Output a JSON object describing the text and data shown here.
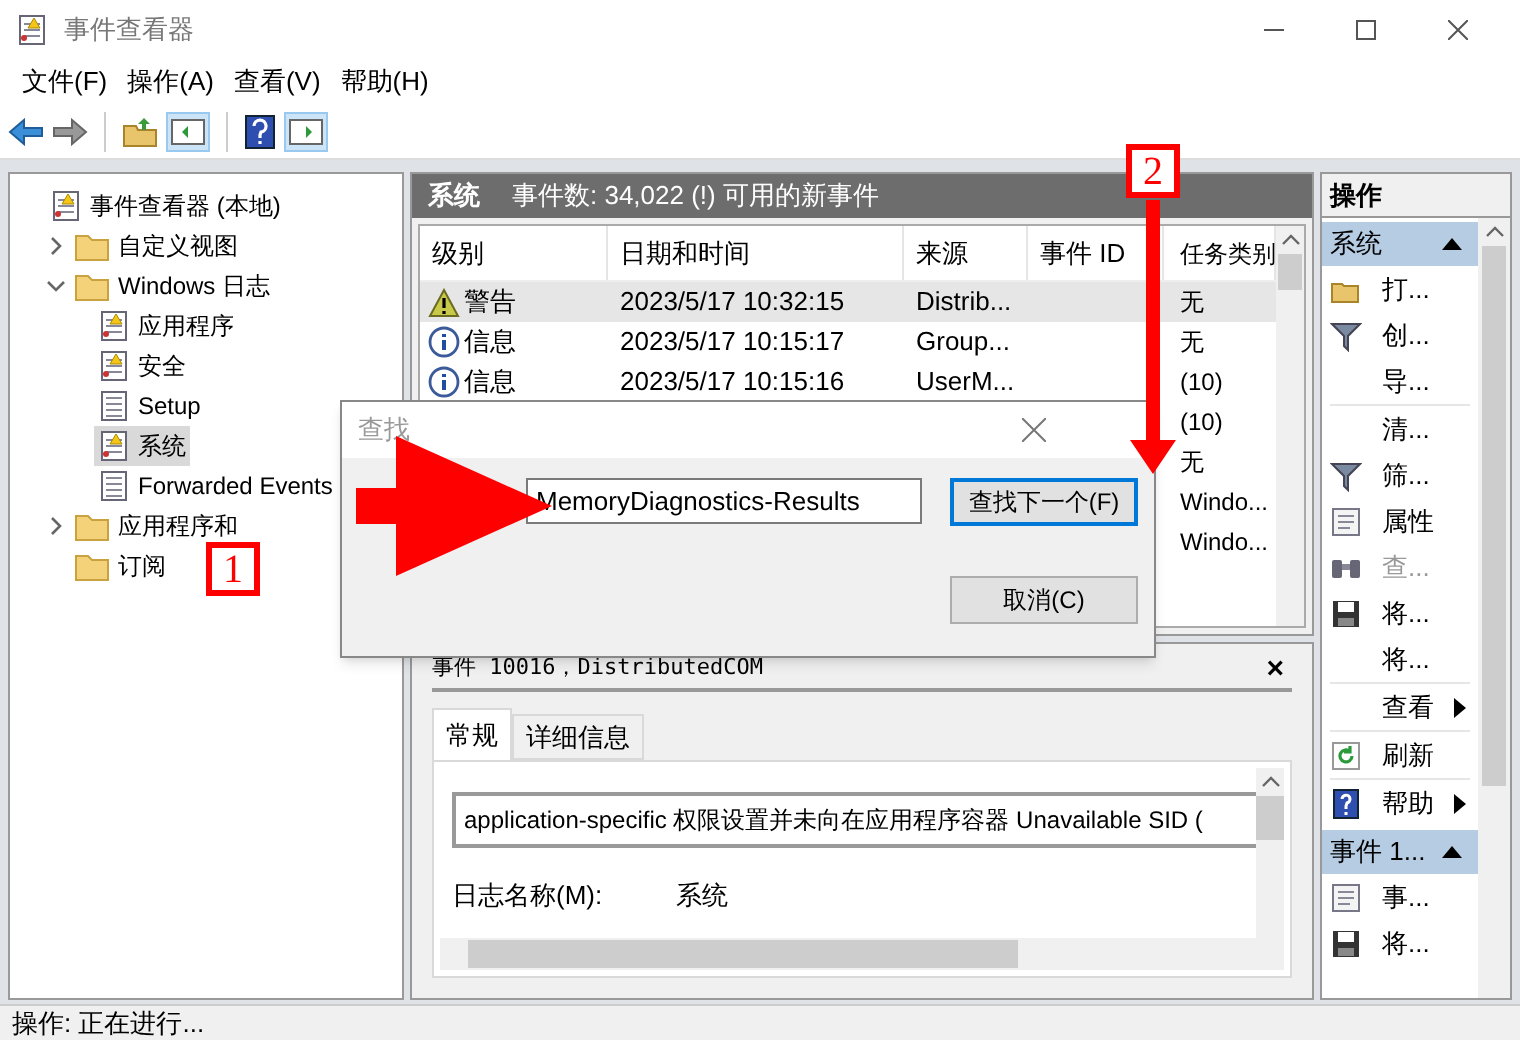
{
  "window": {
    "title": "事件查看器"
  },
  "menu": [
    "文件(F)",
    "操作(A)",
    "查看(V)",
    "帮助(H)"
  ],
  "tree": [
    {
      "label": "事件查看器 (本地)",
      "kind": "log",
      "selected": false,
      "children": [
        {
          "label": "自定义视图",
          "kind": "folder",
          "selected": false,
          "expanded": false
        },
        {
          "label": "Windows 日志",
          "kind": "folder",
          "selected": false,
          "expanded": true,
          "children": [
            {
              "label": "应用程序",
              "kind": "log",
              "selected": false
            },
            {
              "label": "安全",
              "kind": "log",
              "selected": false
            },
            {
              "label": "Setup",
              "kind": "page",
              "selected": false
            },
            {
              "label": "系统",
              "kind": "log",
              "selected": true
            },
            {
              "label": "Forwarded Events",
              "kind": "page",
              "selected": false
            }
          ]
        },
        {
          "label": "应用程序和",
          "kind": "folder",
          "selected": false,
          "expanded": false
        },
        {
          "label": "订阅",
          "kind": "folder",
          "selected": false
        }
      ]
    }
  ],
  "events_header": {
    "title": "系统",
    "summary": "事件数: 34,022 (!) 可用的新事件"
  },
  "table": {
    "columns": [
      "级别",
      "日期和时间",
      "来源",
      "事件 ID",
      "任务类别"
    ],
    "rows": [
      {
        "kind": "warning",
        "level": "警告",
        "date": "2023/5/17 10:32:15",
        "source": "Distrib...",
        "task": "无",
        "selected": true
      },
      {
        "kind": "info",
        "level": "信息",
        "date": "2023/5/17 10:15:17",
        "source": "Group...",
        "task": "无",
        "selected": false
      },
      {
        "kind": "info",
        "level": "信息",
        "date": "2023/5/17 10:15:16",
        "source": "UserM...",
        "task": "(10)",
        "selected": false
      },
      {
        "task": "(10)",
        "selected": false
      },
      {
        "task": "无",
        "selected": false
      },
      {
        "task": "Windo...",
        "selected": false
      },
      {
        "task": "Windo...",
        "selected": false
      }
    ]
  },
  "detail": {
    "title": "事件 10016，DistributedCOM",
    "close": "×",
    "tabs": [
      {
        "label": "常规",
        "selected": true
      },
      {
        "label": "详细信息",
        "selected": false
      }
    ],
    "description": "application-specific 权限设置并未向在应用程序容器 Unavailable SID (",
    "fields": [
      {
        "label": "日志名称(M):",
        "value": "系统"
      }
    ]
  },
  "actions": {
    "title": "操作",
    "sections": [
      {
        "title": "系统",
        "expanded": true,
        "groups": [
          [
            {
              "label": "打...",
              "kind": "open",
              "disabled": false,
              "submenu": false
            },
            {
              "label": "创...",
              "kind": "filter",
              "disabled": false,
              "submenu": false
            },
            {
              "label": "导...",
              "kind": "plain",
              "disabled": false,
              "submenu": false
            }
          ],
          [
            {
              "label": "清...",
              "kind": "plain",
              "disabled": false,
              "submenu": false
            },
            {
              "label": "筛...",
              "kind": "filter",
              "disabled": false,
              "submenu": false
            },
            {
              "label": "属性",
              "kind": "sheet",
              "disabled": false,
              "submenu": false
            },
            {
              "label": "查...",
              "kind": "binoculars",
              "disabled": true,
              "submenu": false
            },
            {
              "label": "将...",
              "kind": "save",
              "disabled": false,
              "submenu": false
            },
            {
              "label": "将...",
              "kind": "plain",
              "disabled": false,
              "submenu": false
            }
          ],
          [
            {
              "label": "查看",
              "kind": "plain",
              "disabled": false,
              "submenu": true
            }
          ],
          [
            {
              "label": "刷新",
              "kind": "refresh",
              "disabled": false,
              "submenu": false
            }
          ],
          [
            {
              "label": "帮助",
              "kind": "help",
              "disabled": false,
              "submenu": true
            }
          ]
        ]
      },
      {
        "title": "事件 1...",
        "expanded": true,
        "groups": [
          [
            {
              "label": "事...",
              "kind": "sheet",
              "disabled": false,
              "submenu": false
            },
            {
              "label": "将...",
              "kind": "save",
              "disabled": false,
              "submenu": false
            }
          ]
        ]
      }
    ]
  },
  "find_dialog": {
    "title": "查找",
    "value": "MemoryDiagnostics-Results",
    "buttons": [
      {
        "label": "查找下一个(F)",
        "default": true
      },
      {
        "label": "取消(C)",
        "default": false
      }
    ]
  },
  "annotations": [
    {
      "label": "1"
    },
    {
      "label": "2"
    }
  ],
  "status_bar": "操作: 正在进行..."
}
